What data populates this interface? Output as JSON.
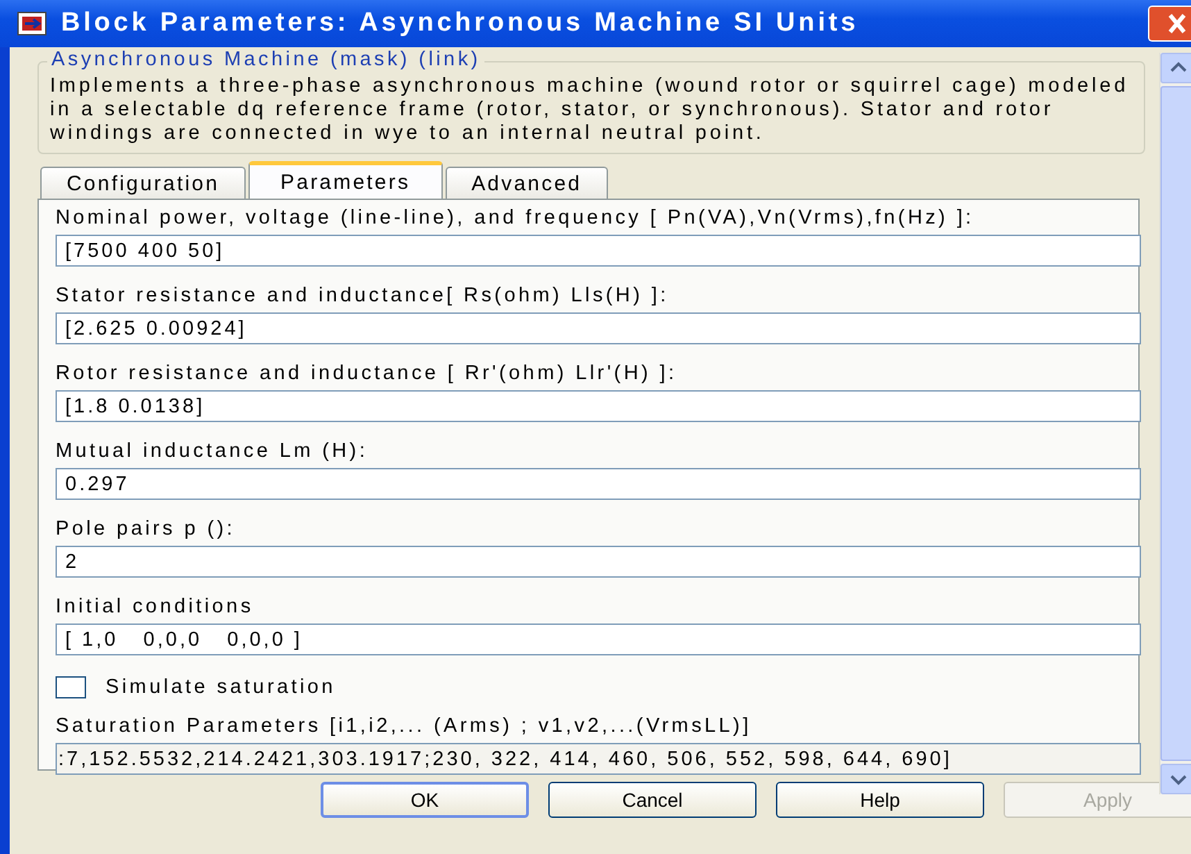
{
  "window": {
    "title": "Block Parameters: Asynchronous Machine SI Units"
  },
  "group": {
    "title": "Asynchronous Machine (mask) (link)",
    "description": "Implements a three-phase asynchronous machine (wound rotor or squirrel cage) modeled in a selectable  dq reference frame (rotor, stator, or synchronous). Stator and rotor windings are connected in wye to an internal neutral point."
  },
  "tabs": [
    {
      "label": "Configuration",
      "selected": false
    },
    {
      "label": "Parameters",
      "selected": true
    },
    {
      "label": "Advanced",
      "selected": false
    }
  ],
  "parameters": [
    {
      "kind": "field",
      "label": "Nominal power, voltage (line-line), and frequency [ Pn(VA),Vn(Vrms),fn(Hz) ]:",
      "value": "[7500 400 50]",
      "disabled": false
    },
    {
      "kind": "field",
      "label": "Stator resistance and inductance[ Rs(ohm)  Lls(H) ]:",
      "value": "[2.625 0.00924]",
      "disabled": false
    },
    {
      "kind": "field",
      "label": "Rotor resistance and inductance [ Rr'(ohm)  Llr'(H) ]:",
      "value": "[1.8 0.0138]",
      "disabled": false
    },
    {
      "kind": "field",
      "label": "Mutual inductance Lm (H):",
      "value": "0.297",
      "disabled": false
    },
    {
      "kind": "field",
      "label": "Pole pairs p ():",
      "value": "2",
      "disabled": false
    },
    {
      "kind": "field",
      "label": "Initial conditions",
      "value": "[ 1,0   0,0,0   0,0,0 ]",
      "disabled": false
    },
    {
      "kind": "checkbox",
      "label": "Simulate saturation",
      "checked": false
    },
    {
      "kind": "field",
      "label": "Saturation Parameters [i1,i2,... (Arms) ; v1,v2,...(VrmsLL)]",
      "value": ":7,152.5532,214.2421,303.1917;230, 322, 414, 460, 506, 552, 598, 644, 690]",
      "disabled": true
    }
  ],
  "buttons": [
    {
      "label": "OK",
      "disabled": false
    },
    {
      "label": "Cancel",
      "disabled": false
    },
    {
      "label": "Help",
      "disabled": false
    },
    {
      "label": "Apply",
      "disabled": true
    }
  ]
}
